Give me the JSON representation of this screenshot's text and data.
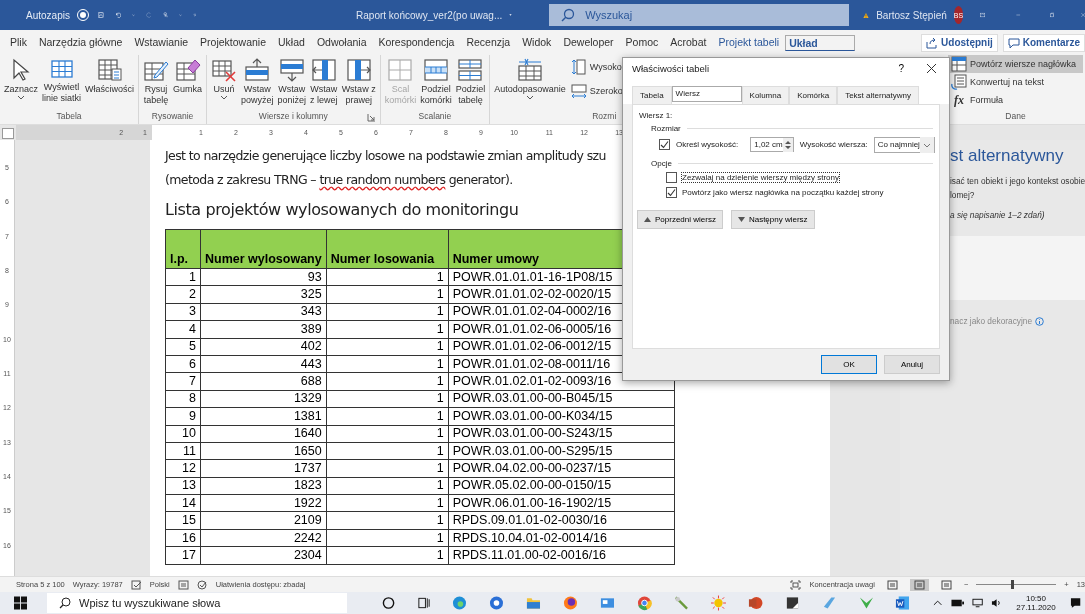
{
  "title_bar": {
    "autosave_label": "Autozapis",
    "autosave_on": false,
    "document_title": "Raport końcowy_ver2(po uwag...",
    "search_placeholder": "Wyszukaj",
    "user_name": "Bartosz Stępień",
    "avatar_initials": "BS"
  },
  "ribbon_tabs": [
    {
      "label": "Plik",
      "selected": false,
      "contextual": false
    },
    {
      "label": "Narzędzia główne",
      "selected": false,
      "contextual": false
    },
    {
      "label": "Wstawianie",
      "selected": false,
      "contextual": false
    },
    {
      "label": "Projektowanie",
      "selected": false,
      "contextual": false
    },
    {
      "label": "Układ",
      "selected": false,
      "contextual": false
    },
    {
      "label": "Odwołania",
      "selected": false,
      "contextual": false
    },
    {
      "label": "Korespondencja",
      "selected": false,
      "contextual": false
    },
    {
      "label": "Recenzja",
      "selected": false,
      "contextual": false
    },
    {
      "label": "Widok",
      "selected": false,
      "contextual": false
    },
    {
      "label": "Deweloper",
      "selected": false,
      "contextual": false
    },
    {
      "label": "Pomoc",
      "selected": false,
      "contextual": false
    },
    {
      "label": "Acrobat",
      "selected": false,
      "contextual": false
    },
    {
      "label": "Projekt tabeli",
      "selected": false,
      "contextual": true
    },
    {
      "label": "Układ",
      "selected": true,
      "contextual": true
    }
  ],
  "share_button": "Udostępnij",
  "comments_button": "Komentarze",
  "ribbon_groups": [
    {
      "label": "Tabela",
      "launcher": false,
      "items": [
        {
          "kind": "large",
          "lines": [
            "Zaznacz"
          ],
          "has_menu": true,
          "disabled": false
        },
        {
          "kind": "large",
          "lines": [
            "Wyświetl",
            "linie siatki"
          ],
          "has_menu": false,
          "disabled": false
        },
        {
          "kind": "large",
          "lines": [
            "Właściwości"
          ],
          "has_menu": false,
          "disabled": false
        }
      ]
    },
    {
      "label": "Rysowanie",
      "launcher": false,
      "items": [
        {
          "kind": "large",
          "lines": [
            "Rysuj",
            "tabelę"
          ],
          "has_menu": false,
          "disabled": false
        },
        {
          "kind": "large",
          "lines": [
            "Gumka"
          ],
          "has_menu": false,
          "disabled": false
        }
      ]
    },
    {
      "label": "Wiersze i kolumny",
      "launcher": true,
      "items": [
        {
          "kind": "large",
          "lines": [
            "Usuń"
          ],
          "has_menu": true,
          "disabled": false
        },
        {
          "kind": "large",
          "lines": [
            "Wstaw",
            "powyżej"
          ],
          "has_menu": false,
          "disabled": false
        },
        {
          "kind": "large",
          "lines": [
            "Wstaw",
            "poniżej"
          ],
          "has_menu": false,
          "disabled": false
        },
        {
          "kind": "large",
          "lines": [
            "Wstaw",
            "z lewej"
          ],
          "has_menu": false,
          "disabled": false
        },
        {
          "kind": "large",
          "lines": [
            "Wstaw z",
            "prawej"
          ],
          "has_menu": false,
          "disabled": false
        }
      ]
    },
    {
      "label": "Scalanie",
      "launcher": false,
      "items": [
        {
          "kind": "large",
          "lines": [
            "Scal",
            "komórki"
          ],
          "has_menu": false,
          "disabled": true
        },
        {
          "kind": "large",
          "lines": [
            "Podziel",
            "komórki"
          ],
          "has_menu": false,
          "disabled": false
        },
        {
          "kind": "large",
          "lines": [
            "Podziel",
            "tabelę"
          ],
          "has_menu": false,
          "disabled": false
        }
      ]
    },
    {
      "label": "Rozmi",
      "launcher": false,
      "items": [
        {
          "kind": "large",
          "lines": [
            "Autodopasowanie"
          ],
          "has_menu": true,
          "disabled": false
        },
        {
          "kind": "small",
          "lines": [
            "Wysoko"
          ],
          "selected": false
        },
        {
          "kind": "small",
          "lines": [
            "Szeroko"
          ],
          "selected": false
        }
      ]
    },
    {
      "label": "Dane",
      "launcher": false,
      "items": [
        {
          "kind": "small",
          "lines": [
            "Powtórz wiersze nagłówka"
          ],
          "selected": true
        },
        {
          "kind": "small",
          "lines": [
            "Konwertuj na tekst"
          ],
          "selected": false
        },
        {
          "kind": "small",
          "lines": [
            "Formuła"
          ],
          "selected": false,
          "glyph": "fx"
        }
      ]
    }
  ],
  "ruler": {
    "left_numbers": [
      "2",
      "1"
    ],
    "numbers": [
      "1",
      "2",
      "3",
      "4",
      "5",
      "6",
      "7",
      "8",
      "9",
      "10",
      "11",
      "12",
      "13"
    ]
  },
  "vertical_ruler": [
    "5",
    "6",
    "7",
    "8",
    "9",
    "10",
    "11",
    "12",
    "13",
    "14",
    "15",
    "16"
  ],
  "document": {
    "paragraph_lines": [
      [
        {
          "text": "Jest to narzędzie generujące liczby losowe na podstawie zmian amplitudy szu",
          "misspelled": false
        }
      ],
      [
        {
          "text": "(metoda z zakresu TRNG – ",
          "misspelled": false
        },
        {
          "text": "true random numbers",
          "misspelled": true
        },
        {
          "text": " generator).",
          "misspelled": false
        }
      ]
    ],
    "heading": "Lista projektów wylosowanych do monitoringu",
    "table": {
      "columns": [
        "l.p.",
        "Numer wylosowany",
        "Numer losowania",
        "Numer umowy"
      ],
      "rows": [
        [
          "1",
          "93",
          "1",
          "POWR.01.01.01-16-1P08/15"
        ],
        [
          "2",
          "325",
          "1",
          "POWR.01.01.02-02-0020/15"
        ],
        [
          "3",
          "343",
          "1",
          "POWR.01.01.02-04-0002/16"
        ],
        [
          "4",
          "389",
          "1",
          "POWR.01.01.02-06-0005/16"
        ],
        [
          "5",
          "402",
          "1",
          "POWR.01.01.02-06-0012/15"
        ],
        [
          "6",
          "443",
          "1",
          "POWR.01.01.02-08-0011/16"
        ],
        [
          "7",
          "688",
          "1",
          "POWR.01.02.01-02-0093/16"
        ],
        [
          "8",
          "1329",
          "1",
          "POWR.03.01.00-00-B045/15"
        ],
        [
          "9",
          "1381",
          "1",
          "POWR.03.01.00-00-K034/15"
        ],
        [
          "10",
          "1640",
          "1",
          "POWR.03.01.00-00-S243/15"
        ],
        [
          "11",
          "1650",
          "1",
          "POWR.03.01.00-00-S295/15"
        ],
        [
          "12",
          "1737",
          "1",
          "POWR.04.02.00-00-0237/15"
        ],
        [
          "13",
          "1823",
          "1",
          "POWR.05.02.00-00-0150/15"
        ],
        [
          "14",
          "1922",
          "1",
          "POWR.06.01.00-16-1902/15"
        ],
        [
          "15",
          "2109",
          "1",
          "RPDS.09.01.01-02-0030/16"
        ],
        [
          "16",
          "2242",
          "1",
          "RPDS.10.04.01-02-0014/16"
        ],
        [
          "17",
          "2304",
          "1",
          "RPDS.11.01.00-02-0016/16"
        ]
      ]
    }
  },
  "alt_text_pane": {
    "title": "st alternatywny",
    "prompt_lines": [
      "isać ten obiekt i jego kontekst osobie",
      "lomej?"
    ],
    "hint": "a się napisanie 1–2 zdań)",
    "decorative_label": "nacz jako dekoracyjne"
  },
  "dialog": {
    "title": "Właściwości tabeli",
    "help": "?",
    "tabs": [
      {
        "label": "Tabela",
        "selected": false
      },
      {
        "label": "Wiersz",
        "selected": true
      },
      {
        "label": "Kolumna",
        "selected": false
      },
      {
        "label": "Komórka",
        "selected": false
      },
      {
        "label": "Tekst alternatywny",
        "selected": false
      }
    ],
    "row_caption": "Wiersz 1:",
    "size_heading": "Rozmiar",
    "specify_height": {
      "label": "Określ wysokość:",
      "checked": true
    },
    "height_value": "1,02 cm",
    "row_height_label": "Wysokość wiersza:",
    "row_height_mode": "Co najmniej",
    "options_heading": "Opcje",
    "options": [
      {
        "label": "Zezwalaj na dzielenie wierszy między strony",
        "checked": false,
        "focused": true
      },
      {
        "label": "Powtórz jako wiersz nagłówka na początku każdej strony",
        "checked": true,
        "focused": false
      }
    ],
    "prev_button": "Poprzedni wiersz",
    "next_button": "Następny wiersz",
    "ok_button": "OK",
    "cancel_button": "Anuluj"
  },
  "status_bar": {
    "page": "Strona 5 z 100",
    "words": "Wyrazy: 19787",
    "language": "Polski",
    "accessibility": "Ułatwienia dostępu: zbadaj",
    "focus": "Koncentracja uwagi",
    "views": [
      {
        "selected": false
      },
      {
        "selected": true
      },
      {
        "selected": false
      }
    ],
    "zoom_minus": "−",
    "zoom_plus": "+",
    "zoom": {
      "level": 0.45
    },
    "zoom_percent": "13"
  },
  "taskbar": {
    "search_placeholder": "Wpisz tu wyszukiwane słowa",
    "time": "10:50",
    "date": "27.11.2020"
  }
}
